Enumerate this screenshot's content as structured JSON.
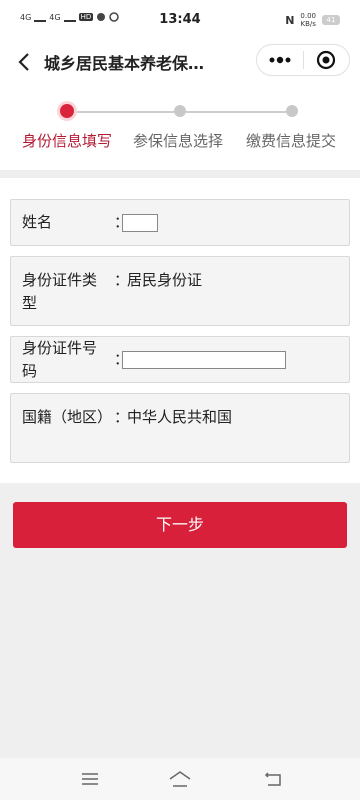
{
  "status_bar": {
    "signal1": "4G",
    "signal2": "4G",
    "hd": "HD",
    "time": "13:44",
    "nfc": "N",
    "speed_value": "0.00",
    "speed_unit": "KB/s",
    "battery": "41"
  },
  "nav": {
    "title": "城乡居民基本养老保…"
  },
  "steps": [
    {
      "label": "身份信息填写",
      "active": true
    },
    {
      "label": "参保信息选择",
      "active": false
    },
    {
      "label": "缴费信息提交",
      "active": false
    }
  ],
  "form": {
    "colon": "：",
    "rows": [
      {
        "label": "姓名",
        "value": "",
        "type": "input-short"
      },
      {
        "label": "身份证件类型",
        "value": "居民身份证",
        "type": "text"
      },
      {
        "label": "身份证件号码",
        "value": "",
        "type": "input-long"
      },
      {
        "label": "国籍（地区）",
        "value": "中华人民共和国",
        "type": "text"
      }
    ]
  },
  "next_button": "下一步",
  "colors": {
    "accent": "#d8203a",
    "active_step_text": "#b31b35"
  }
}
